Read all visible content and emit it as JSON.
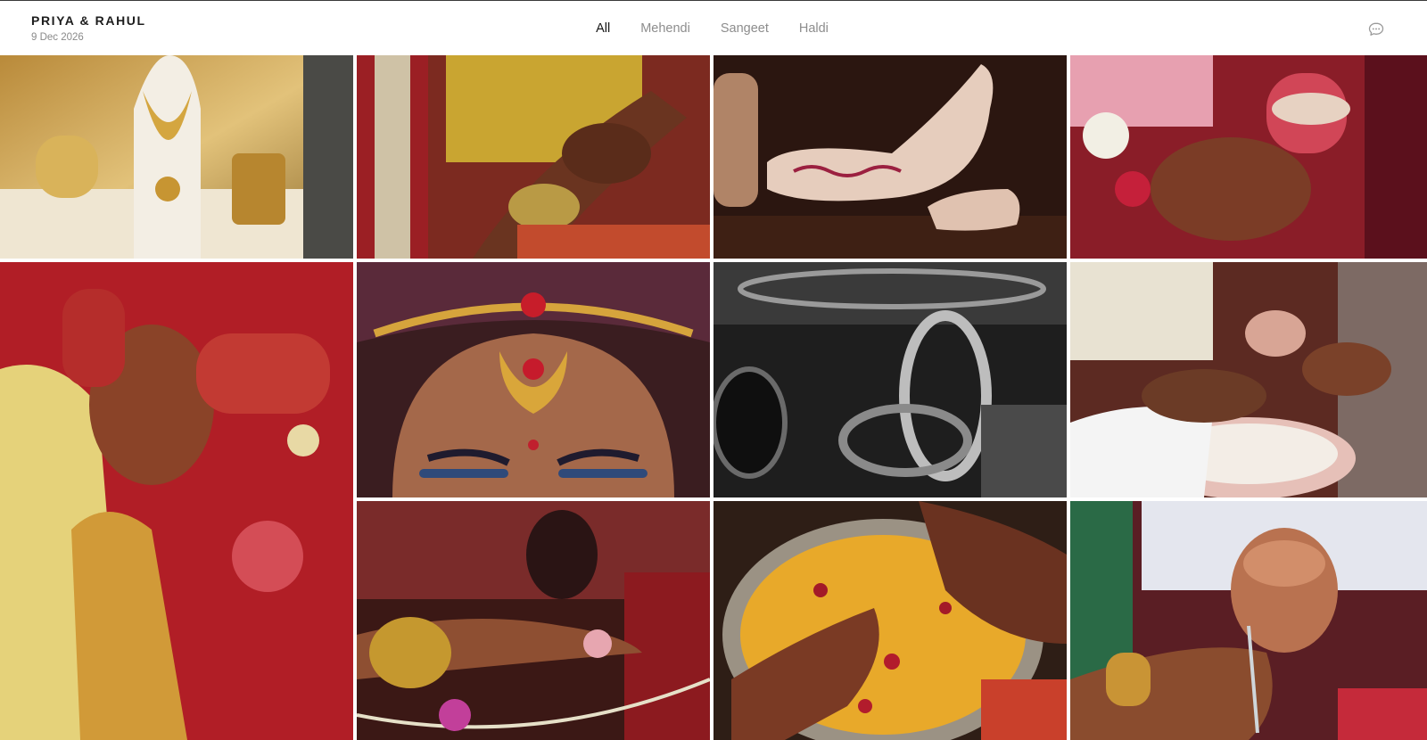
{
  "app": {
    "couple_names": "PRIYA & RAHUL",
    "event_date": "9 Dec 2026"
  },
  "tabs": [
    {
      "label": "All",
      "active": true
    },
    {
      "label": "Mehendi",
      "active": false
    },
    {
      "label": "Sangeet",
      "active": false
    },
    {
      "label": "Haldi",
      "active": false
    }
  ],
  "actions": {
    "chat_icon": "chat-bubble-icon"
  },
  "colors": {
    "active_tab": "#151515",
    "inactive_tab": "#8d8d8d",
    "background": "#ffffff"
  },
  "gallery": {
    "photos": [
      {
        "subject": "gold jewelry display",
        "icon": "image-thumbnail"
      },
      {
        "subject": "henna hands with bangles",
        "icon": "image-thumbnail"
      },
      {
        "subject": "embroidered juttis",
        "icon": "image-thumbnail"
      },
      {
        "subject": "mehndi hands with flowers",
        "icon": "image-thumbnail"
      },
      {
        "subject": "bride hands on red lehenga",
        "icon": "image-thumbnail"
      },
      {
        "subject": "maang tikka closeup",
        "icon": "image-thumbnail"
      },
      {
        "subject": "black and white bangles",
        "icon": "image-thumbnail"
      },
      {
        "subject": "ritual with milk bowl",
        "icon": "image-thumbnail"
      },
      {
        "subject": "hands with rings and garland",
        "icon": "image-thumbnail"
      },
      {
        "subject": "hands over haldi bowl",
        "icon": "image-thumbnail"
      },
      {
        "subject": "copper kalash pouring",
        "icon": "image-thumbnail"
      }
    ]
  }
}
